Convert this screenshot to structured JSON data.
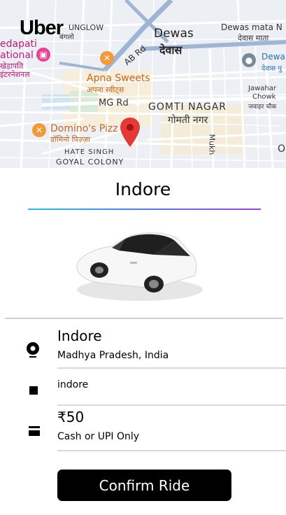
{
  "app": {
    "logo": "Uber"
  },
  "map": {
    "labels": {
      "bunglow": "UNGLOW",
      "bunglow_hi": "बंगलो",
      "edapati": "edapati",
      "national": "ational",
      "edapati_hi": "खेड़ापति",
      "international_hi": "इंटरनेशनल",
      "dewas": "Dewas",
      "dewas_hi": "देवास",
      "dewas_mata": "Dewas mata N",
      "dewas_mata_hi": "देवास माता",
      "dewas2": "Dewa",
      "dewas2_hi": "देवास पु",
      "ab_rd": "AB Rd",
      "apna_sweets": "Apna Sweets",
      "apna_sweets_hi": "अपना स्वीट्स",
      "mg_rd": "MG Rd",
      "gomti_nagar": "GOMTI NAGAR",
      "gomti_nagar_hi": "गोमती नगर",
      "jawahar": "Jawahar",
      "chowk": "Chowk",
      "jawahar_hi": "जवाहर चौक",
      "dominos": "Domino's Pizz",
      "dominos_hi": "डॉमिनो पिज़्ज़ा",
      "hate_singh": "HATE SINGH",
      "goyal_colony": "GOYAL COLONY",
      "mukherjee": "Mukh",
      "ne": "O"
    },
    "colors": {
      "background": "#eceff3",
      "road": "#ffffff",
      "major_road": "#9fb5d6",
      "pin": "#e53935",
      "poi": "#f29a3a",
      "poi_pink": "#e84393"
    }
  },
  "ride": {
    "title": "Indore",
    "pickup": {
      "name": "Indore",
      "region": "Madhya Pradesh, India"
    },
    "destination": {
      "name": "indore"
    },
    "fare": {
      "amount": "₹50",
      "note": "Cash or UPI Only"
    },
    "confirm_label": "Confirm Ride"
  },
  "icons": {
    "pickup": "location-pin-icon",
    "destination": "square-stop-icon",
    "payment": "cash-icon"
  },
  "theme": {
    "accent_gradient": [
      "#22c4e6",
      "#4d7cf0",
      "#9f3ef0"
    ],
    "button": "#000000"
  }
}
